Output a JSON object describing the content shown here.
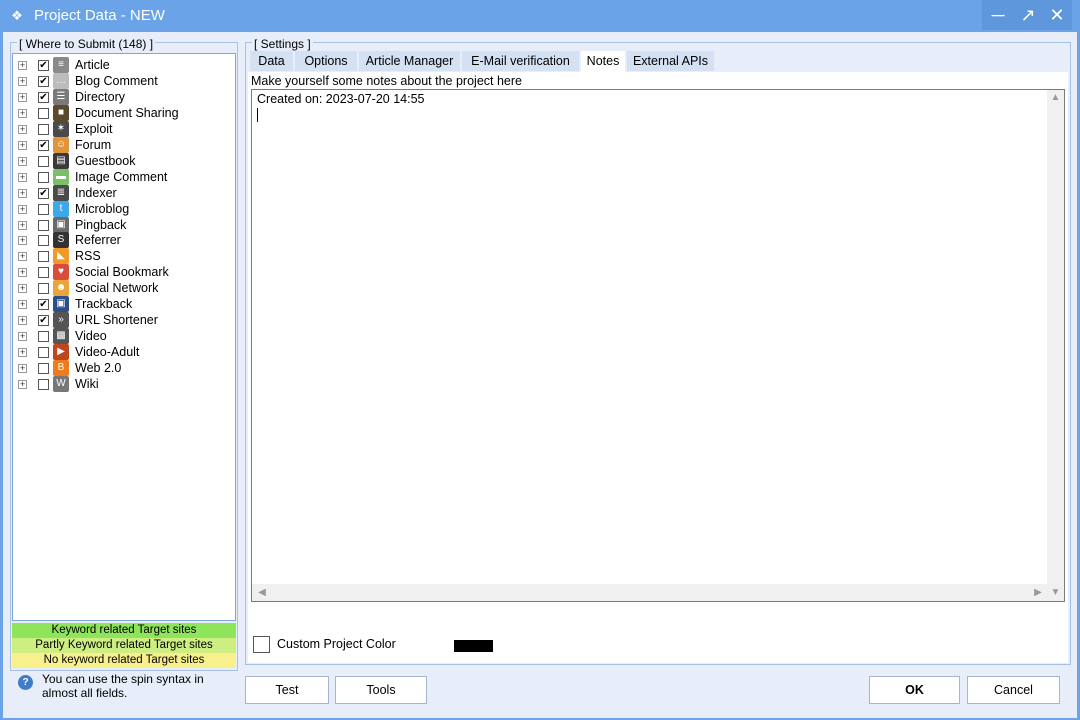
{
  "window": {
    "title": "Project Data - NEW",
    "controls": [
      "minimize",
      "maximize",
      "close"
    ]
  },
  "submit_panel": {
    "title": "[ Where to Submit  (148) ]",
    "items": [
      {
        "label": "Article",
        "checked": true,
        "icon": "article-icon",
        "color": "#8a8a8a"
      },
      {
        "label": "Blog Comment",
        "checked": true,
        "icon": "comment-bubble-icon",
        "color": "#bcbcbc"
      },
      {
        "label": "Directory",
        "checked": true,
        "icon": "directory-icon",
        "color": "#7a7a7a"
      },
      {
        "label": "Document Sharing",
        "checked": false,
        "icon": "folder-icon",
        "color": "#5a4a2a"
      },
      {
        "label": "Exploit",
        "checked": false,
        "icon": "bug-icon",
        "color": "#4a4a4a"
      },
      {
        "label": "Forum",
        "checked": true,
        "icon": "forum-users-icon",
        "color": "#e0953a"
      },
      {
        "label": "Guestbook",
        "checked": false,
        "icon": "book-icon",
        "color": "#3b3b3b"
      },
      {
        "label": "Image Comment",
        "checked": false,
        "icon": "image-icon",
        "color": "#7bbf6a"
      },
      {
        "label": "Indexer",
        "checked": true,
        "icon": "indexer-icon",
        "color": "#4a4a4a"
      },
      {
        "label": "Microblog",
        "checked": false,
        "icon": "twitter-bird-icon",
        "color": "#3da9e8"
      },
      {
        "label": "Pingback",
        "checked": false,
        "icon": "pingback-icon",
        "color": "#6a6a6a"
      },
      {
        "label": "Referrer",
        "checked": false,
        "icon": "referrer-icon",
        "color": "#333333"
      },
      {
        "label": "RSS",
        "checked": false,
        "icon": "rss-icon",
        "color": "#f39a26"
      },
      {
        "label": "Social Bookmark",
        "checked": false,
        "icon": "heart-bookmark-icon",
        "color": "#d94b3b"
      },
      {
        "label": "Social Network",
        "checked": false,
        "icon": "people-icon",
        "color": "#e7a53a"
      },
      {
        "label": "Trackback",
        "checked": true,
        "icon": "trackback-icon",
        "color": "#2d4e8c"
      },
      {
        "label": "URL Shortener",
        "checked": true,
        "icon": "chevrons-icon",
        "color": "#555555"
      },
      {
        "label": "Video",
        "checked": false,
        "icon": "film-icon",
        "color": "#555555"
      },
      {
        "label": "Video-Adult",
        "checked": false,
        "icon": "video-play-icon",
        "color": "#c0461d"
      },
      {
        "label": "Web 2.0",
        "checked": false,
        "icon": "blogger-icon",
        "color": "#f07b1c"
      },
      {
        "label": "Wiki",
        "checked": false,
        "icon": "wiki-icon",
        "color": "#777777"
      }
    ],
    "legend": {
      "keyword": "Keyword related Target sites",
      "partly": "Partly Keyword related Target sites",
      "none": "No keyword related Target sites",
      "keyword_color": "#8ee45a",
      "partly_color": "#cdee82",
      "none_color": "#f7f08d"
    },
    "hint": "You can use the spin syntax in almost all fields."
  },
  "settings": {
    "title": "[ Settings ]",
    "tabs": [
      "Data",
      "Options",
      "Article Manager",
      "E-Mail verification",
      "Notes",
      "External APIs"
    ],
    "active_tab": "Notes",
    "notes_label": "Make yourself some notes about the project here",
    "notes_text": "Created on: 2023-07-20 14:55",
    "custom_color_label": "Custom Project Color",
    "custom_color_checked": false,
    "custom_color_value": "#000000"
  },
  "buttons": {
    "test": "Test",
    "tools": "Tools",
    "ok": "OK",
    "cancel": "Cancel"
  },
  "colors": {
    "titlebar": "#6aa3e8",
    "client_bg": "#e7eef9",
    "tab_bg": "#d4e1f2"
  }
}
